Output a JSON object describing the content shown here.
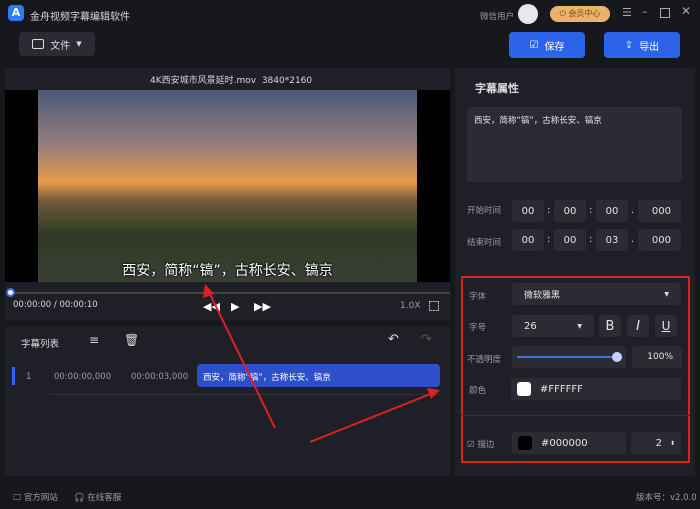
{
  "app": {
    "title": "金舟视频字幕编辑软件",
    "user": "微信用户",
    "vip": "会员中心"
  },
  "toolbar": {
    "file": "文件",
    "save": "保存",
    "export": "导出"
  },
  "video": {
    "filename": "4K西安城市风景延时.mov",
    "resolution": "3840*2160",
    "subtitle": "西安，简称“镐”，古称长安、镐京",
    "time_current": "00:00:00",
    "time_sep": "/",
    "time_total": "00:00:10",
    "speed": "1.0X",
    "progress": 0
  },
  "list": {
    "title": "字幕列表",
    "rows": [
      {
        "index": "1",
        "start": "00:00:00,000",
        "end": "00:00:03,000",
        "text": "西安，简称“镐”，古称长安、镐京"
      }
    ]
  },
  "props": {
    "title": "字幕属性",
    "text": "西安，简称“镐”，古称长安、镐京",
    "start_label": "开始时间",
    "start": [
      "00",
      "00",
      "00",
      "000"
    ],
    "end_label": "结束时间",
    "end": [
      "00",
      "00",
      "03",
      "000"
    ],
    "font_label": "字体",
    "font": "微软雅黑",
    "size_label": "字号",
    "size": "26",
    "bold": "B",
    "italic": "I",
    "underline": "U",
    "opacity_label": "不透明度",
    "opacity": "100%",
    "opacity_value": 1.0,
    "color_label": "颜色",
    "color": "#FFFFFF",
    "stroke_label": "描边",
    "stroke_color": "#000000",
    "stroke_width": "2"
  },
  "footer": {
    "website": "官方网站",
    "support": "在线客服",
    "version": "版本号：v2.0.0"
  },
  "colors": {
    "accent": "#2d63e8",
    "highlight": "#e02020"
  }
}
